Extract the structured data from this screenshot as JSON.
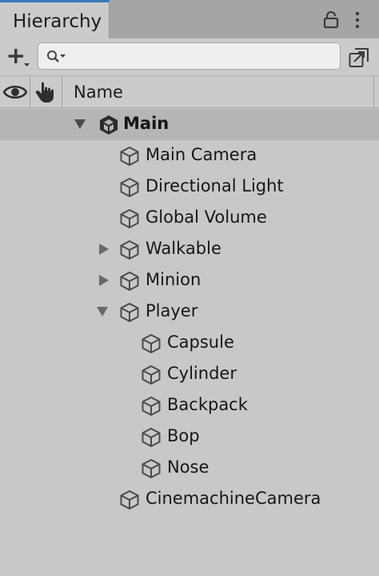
{
  "panel": {
    "tab_title": "Hierarchy",
    "lock_icon": "lock-icon",
    "menu_icon": "kebab-menu-icon"
  },
  "toolbar": {
    "add_icon": "plus-dropdown-icon",
    "search_icon": "search-dropdown-icon",
    "search_value": "",
    "search_placeholder": "",
    "scene_visibility_icon": "scene-overlay-icon"
  },
  "columns": {
    "visibility_icon": "eye-icon",
    "pickability_icon": "hand-pointer-icon",
    "name_label": "Name"
  },
  "tree": {
    "scene": {
      "label": "Main",
      "expanded": true,
      "icon": "unity-scene-icon"
    },
    "items": [
      {
        "label": "Main Camera",
        "depth": 1,
        "has_children": false,
        "expanded": false
      },
      {
        "label": "Directional Light",
        "depth": 1,
        "has_children": false,
        "expanded": false
      },
      {
        "label": "Global Volume",
        "depth": 1,
        "has_children": false,
        "expanded": false
      },
      {
        "label": "Walkable",
        "depth": 1,
        "has_children": true,
        "expanded": false
      },
      {
        "label": "Minion",
        "depth": 1,
        "has_children": true,
        "expanded": false
      },
      {
        "label": "Player",
        "depth": 1,
        "has_children": true,
        "expanded": true
      },
      {
        "label": "Capsule",
        "depth": 2,
        "has_children": false,
        "expanded": false
      },
      {
        "label": "Cylinder",
        "depth": 2,
        "has_children": false,
        "expanded": false
      },
      {
        "label": "Backpack",
        "depth": 2,
        "has_children": false,
        "expanded": false
      },
      {
        "label": "Bop",
        "depth": 2,
        "has_children": false,
        "expanded": false
      },
      {
        "label": "Nose",
        "depth": 2,
        "has_children": false,
        "expanded": false
      },
      {
        "label": "CinemachineCamera",
        "depth": 1,
        "has_children": false,
        "expanded": false
      }
    ]
  },
  "colors": {
    "tab_accent": "#3a79bb",
    "panel_bg": "#c8c8c8",
    "scene_row_bg": "#b5b5b5",
    "icon_color": "#4a4a4a"
  }
}
